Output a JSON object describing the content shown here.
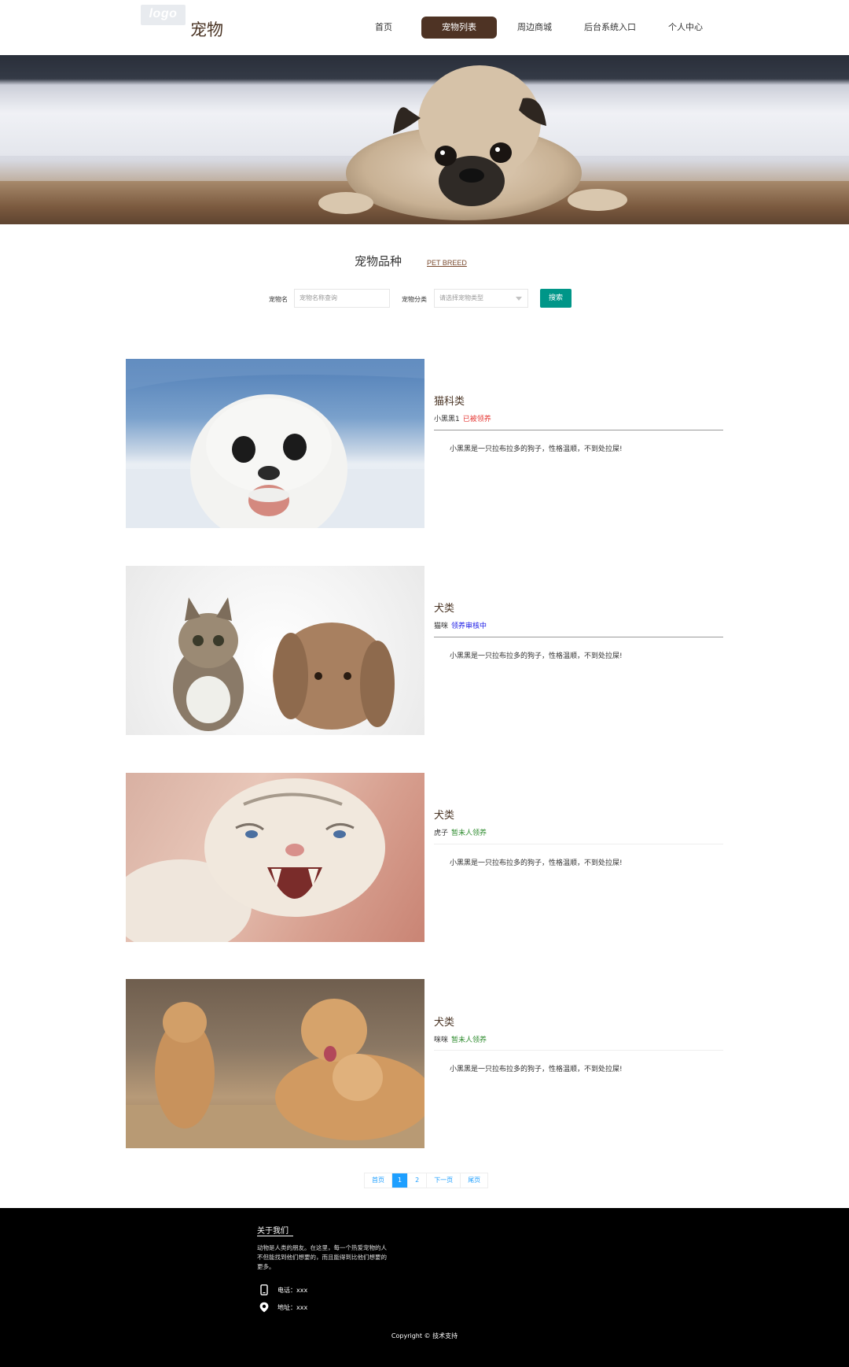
{
  "header": {
    "logo_text": "logo",
    "brand": "宠物",
    "nav": [
      "首页",
      "宠物列表",
      "周边商城",
      "后台系统入口",
      "个人中心"
    ],
    "active_index": 1
  },
  "section": {
    "title": "宠物品种",
    "subtitle": "PET BREED"
  },
  "search": {
    "name_label": "宠物名",
    "name_placeholder": "宠物名称查询",
    "category_label": "宠物分类",
    "category_placeholder": "请选择宠物类型",
    "button": "搜索"
  },
  "pets": [
    {
      "category": "猫科类",
      "name": "小黑黑1",
      "status": "已被领养",
      "status_color": "#e53935",
      "desc": "小黑黑是一只拉布拉多的狗子，性格温顺，不到处拉屎!"
    },
    {
      "category": "犬类",
      "name": "猫咪",
      "status": "领养审核中",
      "status_color": "#1a1ae6",
      "desc": "小黑黑是一只拉布拉多的狗子，性格温顺，不到处拉屎!"
    },
    {
      "category": "犬类",
      "name": "虎子",
      "status": "暂未人领养",
      "status_color": "#2e8b2e",
      "desc": "小黑黑是一只拉布拉多的狗子，性格温顺，不到处拉屎!"
    },
    {
      "category": "犬类",
      "name": "咪咪",
      "status": "暂未人领养",
      "status_color": "#2e8b2e",
      "desc": "小黑黑是一只拉布拉多的狗子，性格温顺，不到处拉屎!"
    }
  ],
  "pagination": {
    "first": "首页",
    "pages": [
      "1",
      "2"
    ],
    "current": "1",
    "next": "下一页",
    "last": "尾页"
  },
  "footer": {
    "about_title": "关于我们",
    "about_text": "动物是人类的朋友。在这里，每一个热爱宠物的人不但能找到他们想要的，而且能得到比他们想要的更多。",
    "phone_label": "电话：",
    "phone": "xxx",
    "address_label": "地址：",
    "address": "xxx",
    "copyright": "Copyright © 技术支持"
  },
  "colors": {
    "accent": "#4e3324",
    "search_button": "#009688",
    "pager": "#1e9fff"
  }
}
